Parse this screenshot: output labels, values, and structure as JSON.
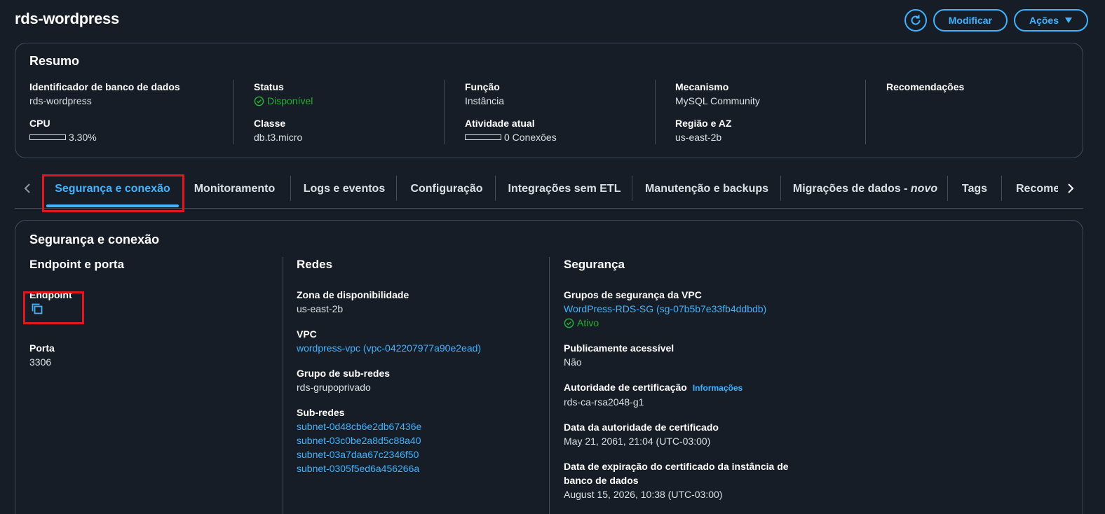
{
  "header": {
    "title": "rds-wordpress",
    "modify_label": "Modificar",
    "actions_label": "Ações"
  },
  "summary": {
    "title": "Resumo",
    "db_identifier": {
      "label": "Identificador de banco de dados",
      "value": "rds-wordpress"
    },
    "cpu": {
      "label": "CPU",
      "value": "3.30%",
      "fraction": 0.033
    },
    "status": {
      "label": "Status",
      "value": "Disponível"
    },
    "class": {
      "label": "Classe",
      "value": "db.t3.micro"
    },
    "role": {
      "label": "Função",
      "value": "Instância"
    },
    "activity": {
      "label": "Atividade atual",
      "value": "0 Conexões",
      "fraction": 0
    },
    "engine": {
      "label": "Mecanismo",
      "value": "MySQL Community"
    },
    "region": {
      "label": "Região e AZ",
      "value": "us-east-2b"
    },
    "recommendations": {
      "label": "Recomendações"
    }
  },
  "tabs": [
    {
      "label": "Segurança e conexão",
      "active": true
    },
    {
      "label": "Monitoramento"
    },
    {
      "label": "Logs e eventos"
    },
    {
      "label": "Configuração"
    },
    {
      "label": "Integrações sem ETL"
    },
    {
      "label": "Manutenção e backups"
    },
    {
      "label": "Migrações de dados - ",
      "suffix": "novo"
    },
    {
      "label": "Tags"
    },
    {
      "label": "Recome"
    }
  ],
  "security": {
    "title": "Segurança e conexão",
    "endpoint_col": {
      "heading": "Endpoint e porta",
      "endpoint_label": "Endpoint",
      "port_label": "Porta",
      "port_value": "3306"
    },
    "network_col": {
      "heading": "Redes",
      "az_label": "Zona de disponibilidade",
      "az_value": "us-east-2b",
      "vpc_label": "VPC",
      "vpc_value": "wordpress-vpc (vpc-042207977a90e2ead)",
      "subnet_group_label": "Grupo de sub-redes",
      "subnet_group_value": "rds-grupoprivado",
      "subnets_label": "Sub-redes",
      "subnets": [
        "subnet-0d48cb6e2db67436e",
        "subnet-03c0be2a8d5c88a40",
        "subnet-03a7daa67c2346f50",
        "subnet-0305f5ed6a456266a"
      ]
    },
    "security_col": {
      "heading": "Segurança",
      "vpc_sg_label": "Grupos de segurança da VPC",
      "vpc_sg_value": "WordPress-RDS-SG (sg-07b5b7e33fb4ddbdb)",
      "vpc_sg_status": "Ativo",
      "public_label": "Publicamente acessível",
      "public_value": "Não",
      "ca_label": "Autoridade de certificação",
      "ca_info": "Informações",
      "ca_value": "rds-ca-rsa2048-g1",
      "ca_date_label": "Data da autoridade de certificado",
      "ca_date_value": "May 21, 2061, 21:04 (UTC-03:00)",
      "cert_exp_label_1": "Data de expiração do certificado da instância de",
      "cert_exp_label_2": "banco de dados",
      "cert_exp_value": "August 15, 2026, 10:38 (UTC-03:00)"
    }
  },
  "colors": {
    "background": "#161d26",
    "accent": "#42b4ff",
    "success": "#29ad32",
    "highlight": "#e0171f",
    "border": "#414d5c"
  }
}
